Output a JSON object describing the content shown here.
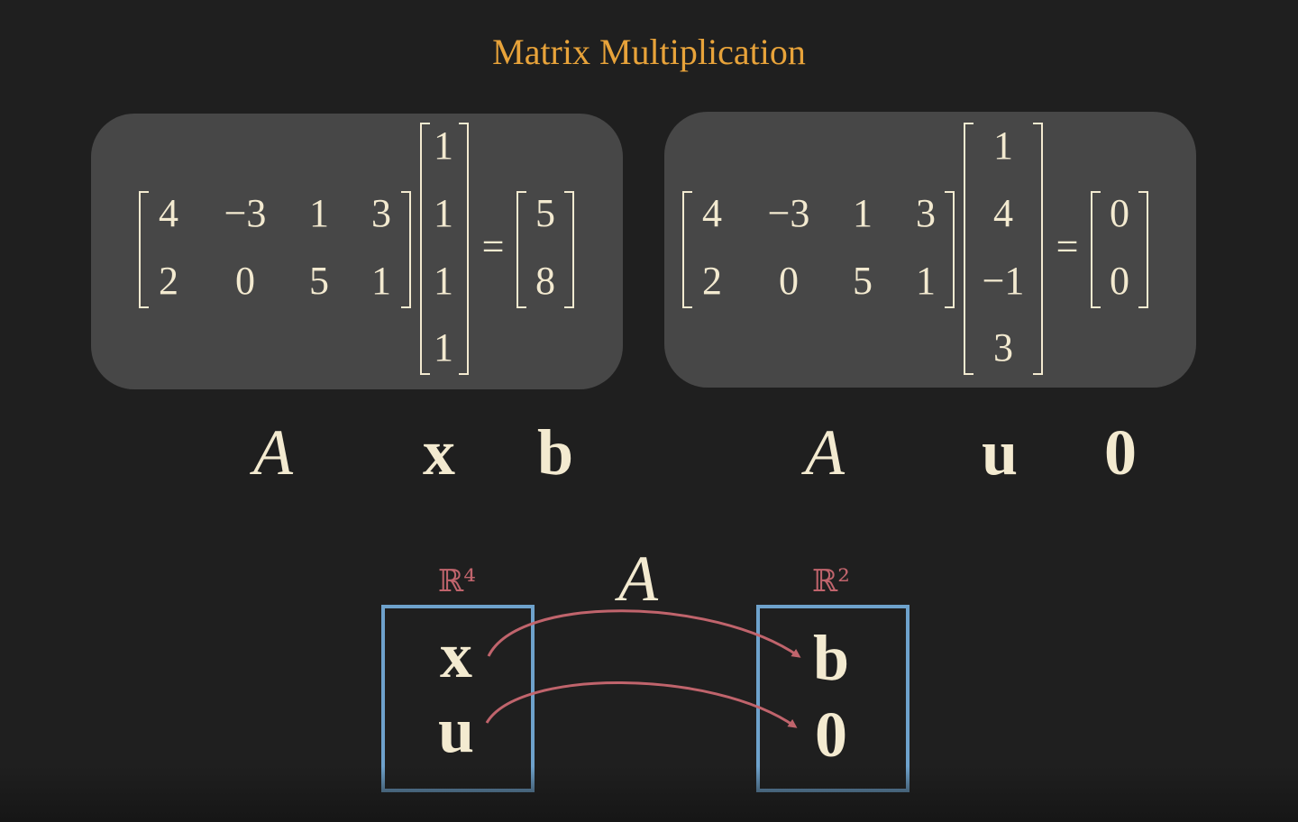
{
  "title": "Matrix Multiplication",
  "left_equation": {
    "matrix_A": [
      [
        "4",
        "−3",
        "1",
        "3"
      ],
      [
        "2",
        "0",
        "5",
        "1"
      ]
    ],
    "vector_x": [
      "1",
      "1",
      "1",
      "1"
    ],
    "equals": "=",
    "vector_b": [
      "5",
      "8"
    ],
    "labels": {
      "A": "A",
      "x": "x",
      "b": "b"
    }
  },
  "right_equation": {
    "matrix_A": [
      [
        "4",
        "−3",
        "1",
        "3"
      ],
      [
        "2",
        "0",
        "5",
        "1"
      ]
    ],
    "vector_u": [
      "1",
      "4",
      "−1",
      "3"
    ],
    "equals": "=",
    "vector_zero": [
      "0",
      "0"
    ],
    "labels": {
      "A": "A",
      "u": "u",
      "zero": "0"
    }
  },
  "mapping": {
    "domain_label": "ℝ⁴",
    "codomain_label": "ℝ²",
    "map_label": "A",
    "domain_items": [
      "x",
      "u"
    ],
    "codomain_items": [
      "b",
      "0"
    ],
    "arrow_color": "#c0646c",
    "box_color": "#6ea2cc"
  },
  "colors": {
    "background": "#1f1f1f",
    "panel": "#474747",
    "title": "#e8a33a",
    "text": "#f3ead0"
  }
}
